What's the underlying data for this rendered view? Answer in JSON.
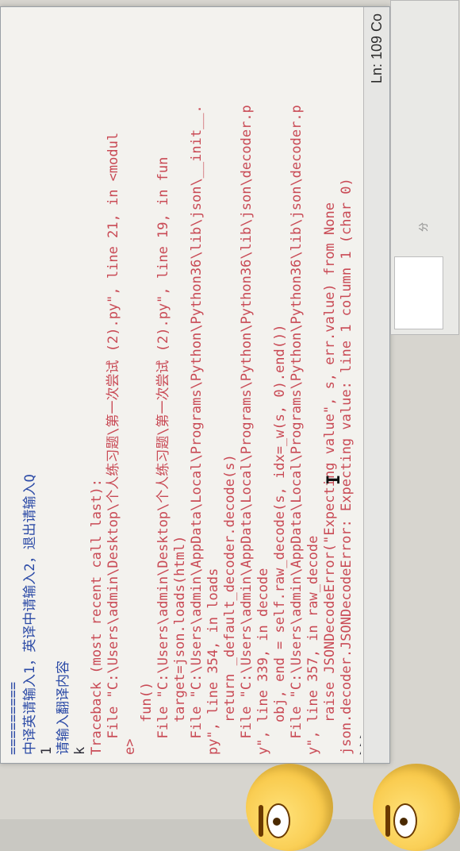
{
  "shell": {
    "lines": [
      {
        "text": "=========",
        "color": "blue"
      },
      {
        "text": "中译英请输入1，英译中请输入2，退出请输入Q",
        "color": "blue"
      },
      {
        "text": "1",
        "color": "dark"
      },
      {
        "text": "请输入翻译内容",
        "color": "blue"
      },
      {
        "text": "k",
        "color": "dark"
      },
      {
        "text": "Traceback (most recent call last):",
        "color": "red"
      },
      {
        "text": "  File \"C:\\Users\\admin\\Desktop\\个人练习题\\第一次尝试 (2).py\", line 21, in <modul",
        "color": "red"
      },
      {
        "text": "e>",
        "color": "red"
      },
      {
        "text": "    fun()",
        "color": "red"
      },
      {
        "text": "  File \"C:\\Users\\admin\\Desktop\\个人练习题\\第一次尝试 (2).py\", line 19, in fun",
        "color": "red"
      },
      {
        "text": "    target=json.loads(html)",
        "color": "red"
      },
      {
        "text": "  File \"C:\\Users\\admin\\AppData\\Local\\Programs\\Python\\Python36\\lib\\json\\__init__.",
        "color": "red"
      },
      {
        "text": "py\", line 354, in loads",
        "color": "red"
      },
      {
        "text": "    return _default_decoder.decode(s)",
        "color": "red"
      },
      {
        "text": "  File \"C:\\Users\\admin\\AppData\\Local\\Programs\\Python\\Python36\\lib\\json\\decoder.p",
        "color": "red"
      },
      {
        "text": "y\", line 339, in decode",
        "color": "red"
      },
      {
        "text": "    obj, end = self.raw_decode(s, idx=_w(s, 0).end())",
        "color": "red"
      },
      {
        "text": "  File \"C:\\Users\\admin\\AppData\\Local\\Programs\\Python\\Python36\\lib\\json\\decoder.p",
        "color": "red"
      },
      {
        "text": "y\", line 357, in raw_decode",
        "color": "red"
      },
      {
        "text": "    raise JSONDecodeError(\"Expecting value\", s, err.value) from None",
        "color": "red"
      },
      {
        "text": "json.decoder.JSONDecodeError: Expecting value: line 1 column 1 (char 0)",
        "color": "red"
      },
      {
        "text": ">>> ",
        "color": "dark"
      }
    ]
  },
  "statusbar": {
    "position": "Ln: 109 Co"
  },
  "side_panel": {
    "label": "分"
  },
  "colors": {
    "blue": "#2b4aa6",
    "red": "#c94a55",
    "dark": "#2f2f3a"
  }
}
